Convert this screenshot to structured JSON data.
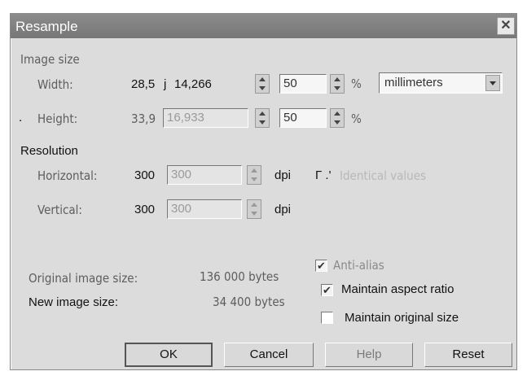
{
  "dialog": {
    "title": "Resample",
    "close_glyph": "✕"
  },
  "image_size": {
    "section_label": "Image size",
    "width_label": "Width:",
    "width_original": "28,5",
    "width_marker": "j",
    "width_value": "14,266",
    "width_percent": "50",
    "height_label": "Height:",
    "height_original": "33,9",
    "height_value": "16,933",
    "height_percent": "50",
    "percent_symbol": "%",
    "units": "millimeters",
    "stray_mark": "."
  },
  "resolution": {
    "section_label": "Resolution",
    "horizontal_label": "Horizontal:",
    "horizontal_original": "300",
    "horizontal_value": "300",
    "vertical_label": "Vertical:",
    "vertical_original": "300",
    "vertical_value": "300",
    "unit": "dpi",
    "identical_checkbox_label": "Identical values",
    "identical_checkbox_prefix": "Γ .'"
  },
  "info": {
    "original_label": "Original image size:",
    "original_value": "136 000 bytes",
    "new_label": "New image size:",
    "new_value": "34 400 bytes"
  },
  "options": {
    "anti_alias_label": "Anti-alias",
    "anti_alias_checked": true,
    "maintain_aspect_label": "Maintain aspect ratio",
    "maintain_aspect_checked": true,
    "maintain_original_label": "Maintain original size",
    "maintain_original_checked": false
  },
  "buttons": {
    "ok": "OK",
    "cancel": "Cancel",
    "help": "Help",
    "reset": "Reset"
  },
  "colors": {
    "dialog_bg": "#dcdcdc",
    "titlebar": "#808080"
  }
}
